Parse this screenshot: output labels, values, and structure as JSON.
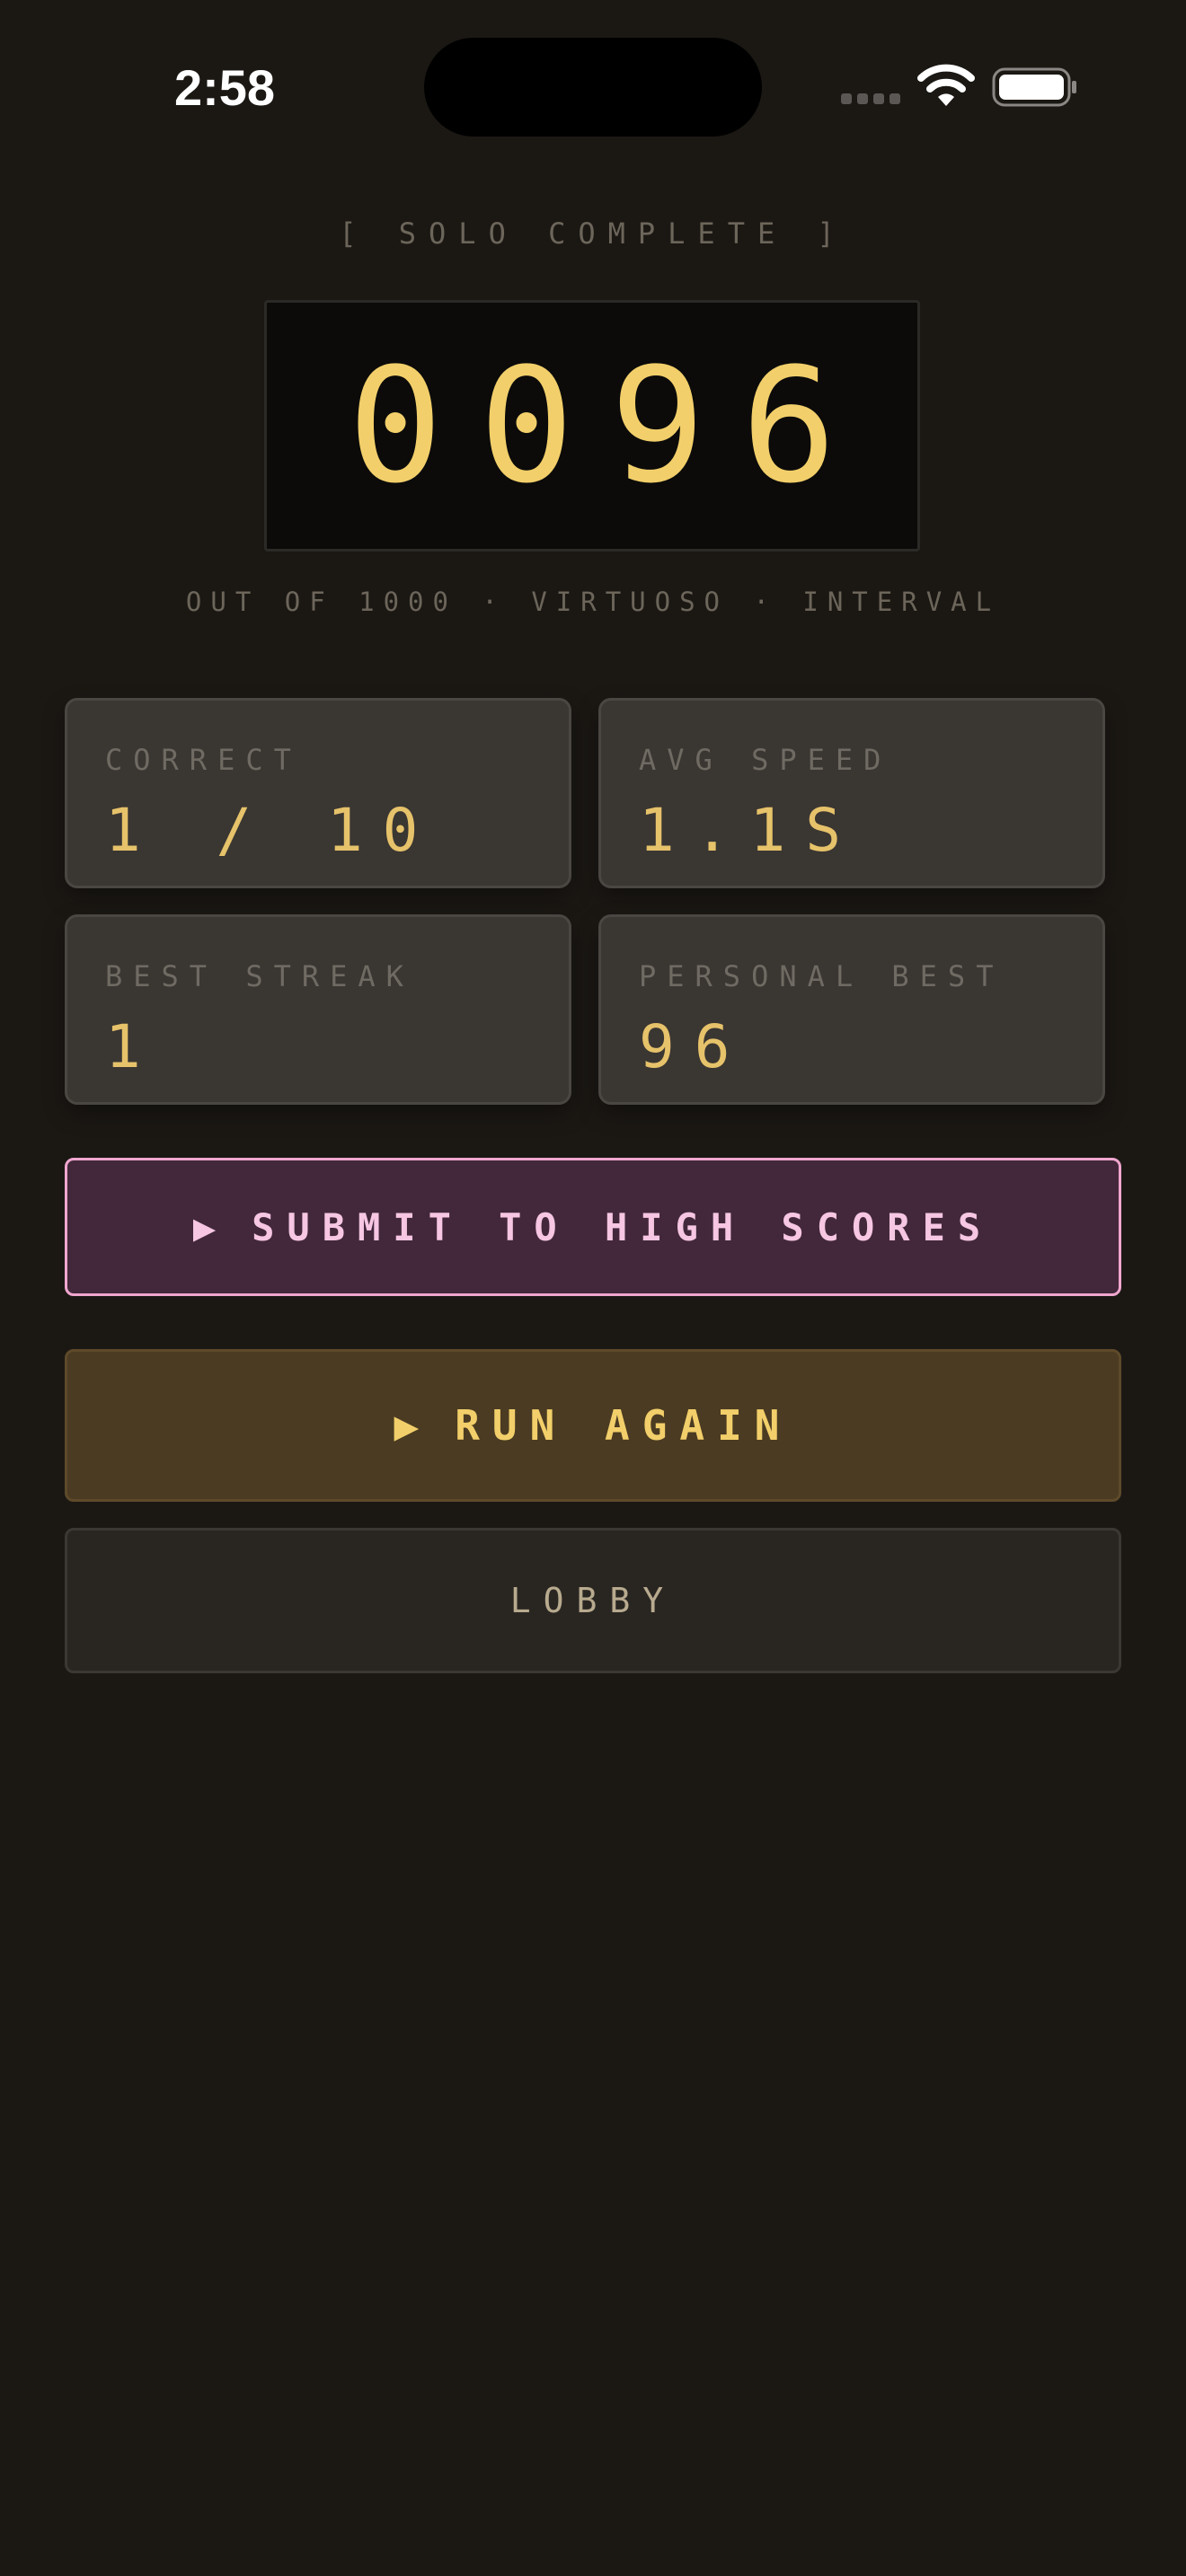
{
  "status_bar": {
    "time": "2:58"
  },
  "header": {
    "eyebrow": "[ SOLO COMPLETE ]",
    "score": "0096",
    "subtitle": "OUT OF 1000 · VIRTUOSO · INTERVAL"
  },
  "stats": [
    {
      "label": "CORRECT",
      "value": "1 / 10"
    },
    {
      "label": "AVG SPEED",
      "value": "1.1S"
    },
    {
      "label": "BEST STREAK",
      "value": "1"
    },
    {
      "label": "PERSONAL BEST",
      "value": "96"
    }
  ],
  "actions": {
    "submit_icon": "▶",
    "submit_label": "SUBMIT TO HIGH SCORES",
    "run_icon": "▶",
    "run_label": "RUN AGAIN",
    "lobby_label": "LOBBY"
  },
  "colors": {
    "background": "#1b1814",
    "accent_gold": "#f2cf6a",
    "accent_pink": "#f0a6cf",
    "muted_text": "#6c655a"
  },
  "icons": {
    "signal": "cellular-signal-icon",
    "wifi": "wifi-icon",
    "battery": "battery-icon",
    "play": "play-triangle-icon"
  }
}
